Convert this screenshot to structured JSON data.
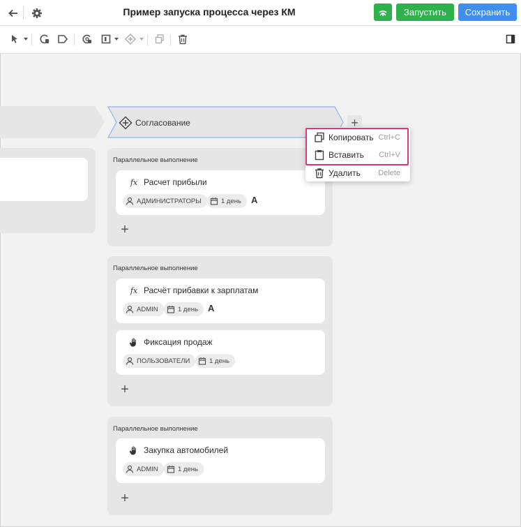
{
  "header": {
    "title": "Пример запуска процесса через КМ",
    "run_label": "Запустить",
    "save_label": "Сохранить"
  },
  "stage": {
    "label": "Согласование"
  },
  "groups": [
    {
      "title": "Параллельное выполнение",
      "cards": [
        {
          "icon": "function-icon",
          "title": "Расчет прибыли",
          "role": "АДМИНИСТРАТОРЫ",
          "duration": "1 день",
          "badge": "A"
        }
      ]
    },
    {
      "title": "Параллельное выполнение",
      "cards": [
        {
          "icon": "function-icon",
          "title": "Расчёт прибавки к зарплатам",
          "role": "ADMIN",
          "duration": "1 день",
          "badge": "A"
        },
        {
          "icon": "hand-icon",
          "title": "Фиксация продаж",
          "role": "ПОЛЬЗОВАТЕЛИ",
          "duration": "1 день"
        }
      ]
    },
    {
      "title": "Параллельное выполнение",
      "cards": [
        {
          "icon": "hand-icon",
          "title": "Закупка автомобилей",
          "role": "ADMIN",
          "duration": "1 день"
        }
      ]
    }
  ],
  "context_menu": {
    "items": [
      {
        "label": "Копировать",
        "shortcut": "Ctrl+C",
        "icon": "copy-icon"
      },
      {
        "label": "Вставить",
        "shortcut": "Ctrl+V",
        "icon": "paste-icon"
      },
      {
        "label": "Удалить",
        "shortcut": "Delete",
        "icon": "trash-icon"
      }
    ],
    "highlight_color": "#e6366f"
  },
  "colors": {
    "run_button": "#2fb24e",
    "save_button": "#3f8ef0",
    "stage_selected_border": "#8ab6f0"
  }
}
